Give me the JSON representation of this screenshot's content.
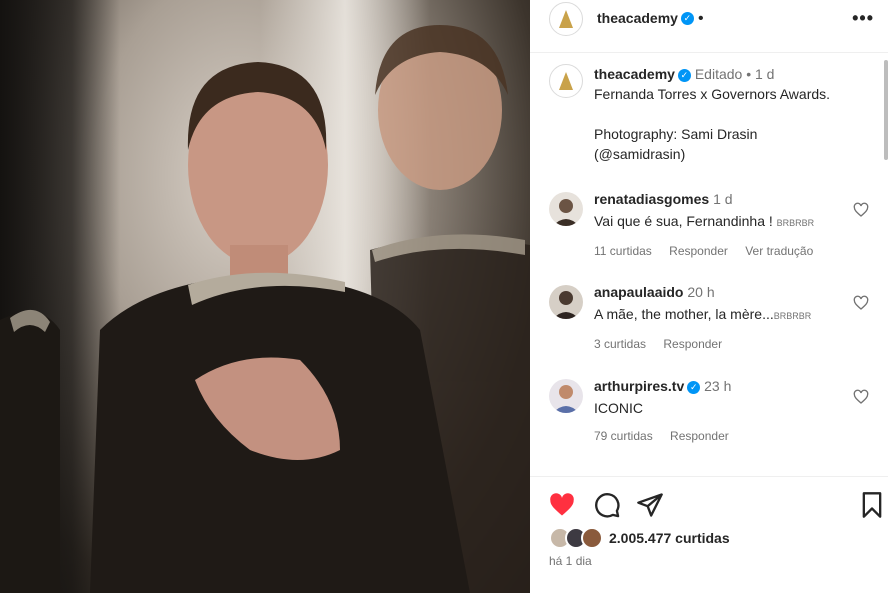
{
  "post": {
    "account": "theacademy",
    "header_dot": "•",
    "more_label": "•••"
  },
  "caption": {
    "username": "theacademy",
    "edited": "Editado",
    "sep": "•",
    "age": "1 d",
    "text": "Fernanda Torres x Governors Awards.\n\nPhotography: Sami Drasin\n(@samidrasin)"
  },
  "comments": [
    {
      "username": "renatadiasgomes",
      "age": "1 d",
      "text": "Vai que é sua, Fernandinha !",
      "tag": "BRBRBR",
      "likes": "11 curtidas",
      "reply": "Responder",
      "translate": "Ver tradução"
    },
    {
      "username": "anapaulaaido",
      "age": "20 h",
      "text": "A mãe, the mother, la mère...",
      "tag": "BRBRBR",
      "likes": "3 curtidas",
      "reply": "Responder"
    },
    {
      "username": "arthurpires.tv",
      "age": "23 h",
      "text": "ICONIC",
      "likes": "79 curtidas",
      "reply": "Responder"
    }
  ],
  "footer": {
    "likes": "2.005.477 curtidas",
    "posted": "há 1 dia"
  },
  "colors": {
    "like_red": "#ff3040",
    "verified_blue": "#0095f6",
    "academy_gold": "#c9a24a"
  }
}
